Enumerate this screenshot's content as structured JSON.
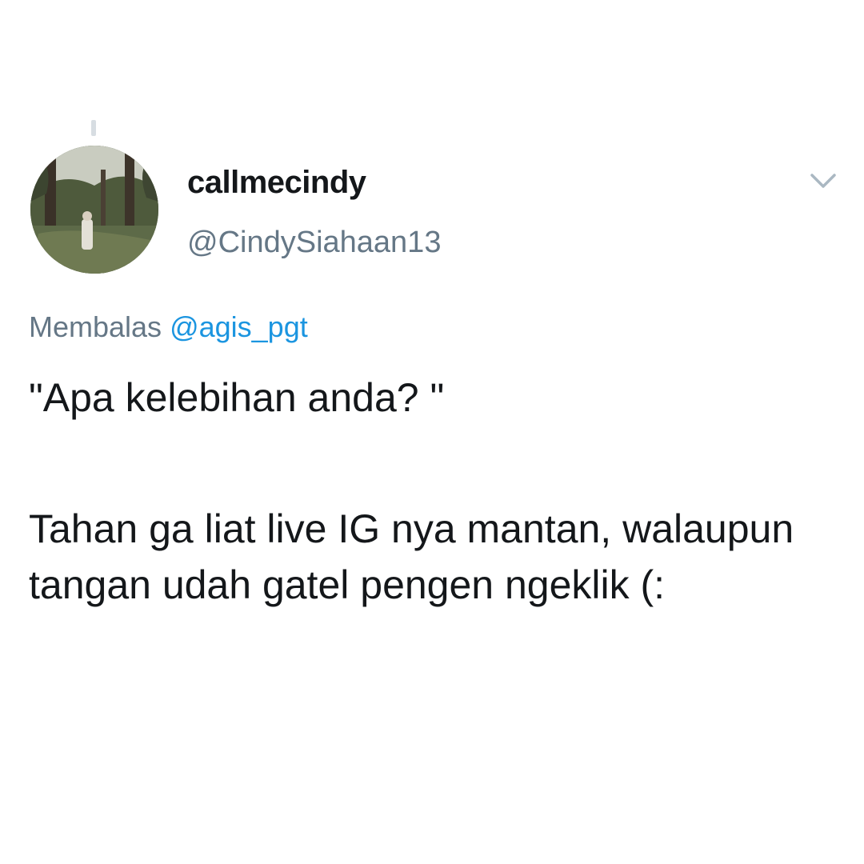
{
  "tweet": {
    "display_name": "callmecindy",
    "handle": "@CindySiahaan13",
    "reply_prefix": "Membalas",
    "reply_mention": "@agis_pgt",
    "text_line_1": "\"Apa kelebihan anda? \"",
    "text_body": "Tahan ga liat live IG nya mantan, walaupun tangan udah gatel pengen ngeklik (:"
  },
  "icons": {
    "menu": "chevron-down-icon",
    "avatar": "profile-photo"
  },
  "colors": {
    "name": "#14171a",
    "secondary": "#657786",
    "mention": "#1b95e0",
    "background": "#ffffff"
  }
}
